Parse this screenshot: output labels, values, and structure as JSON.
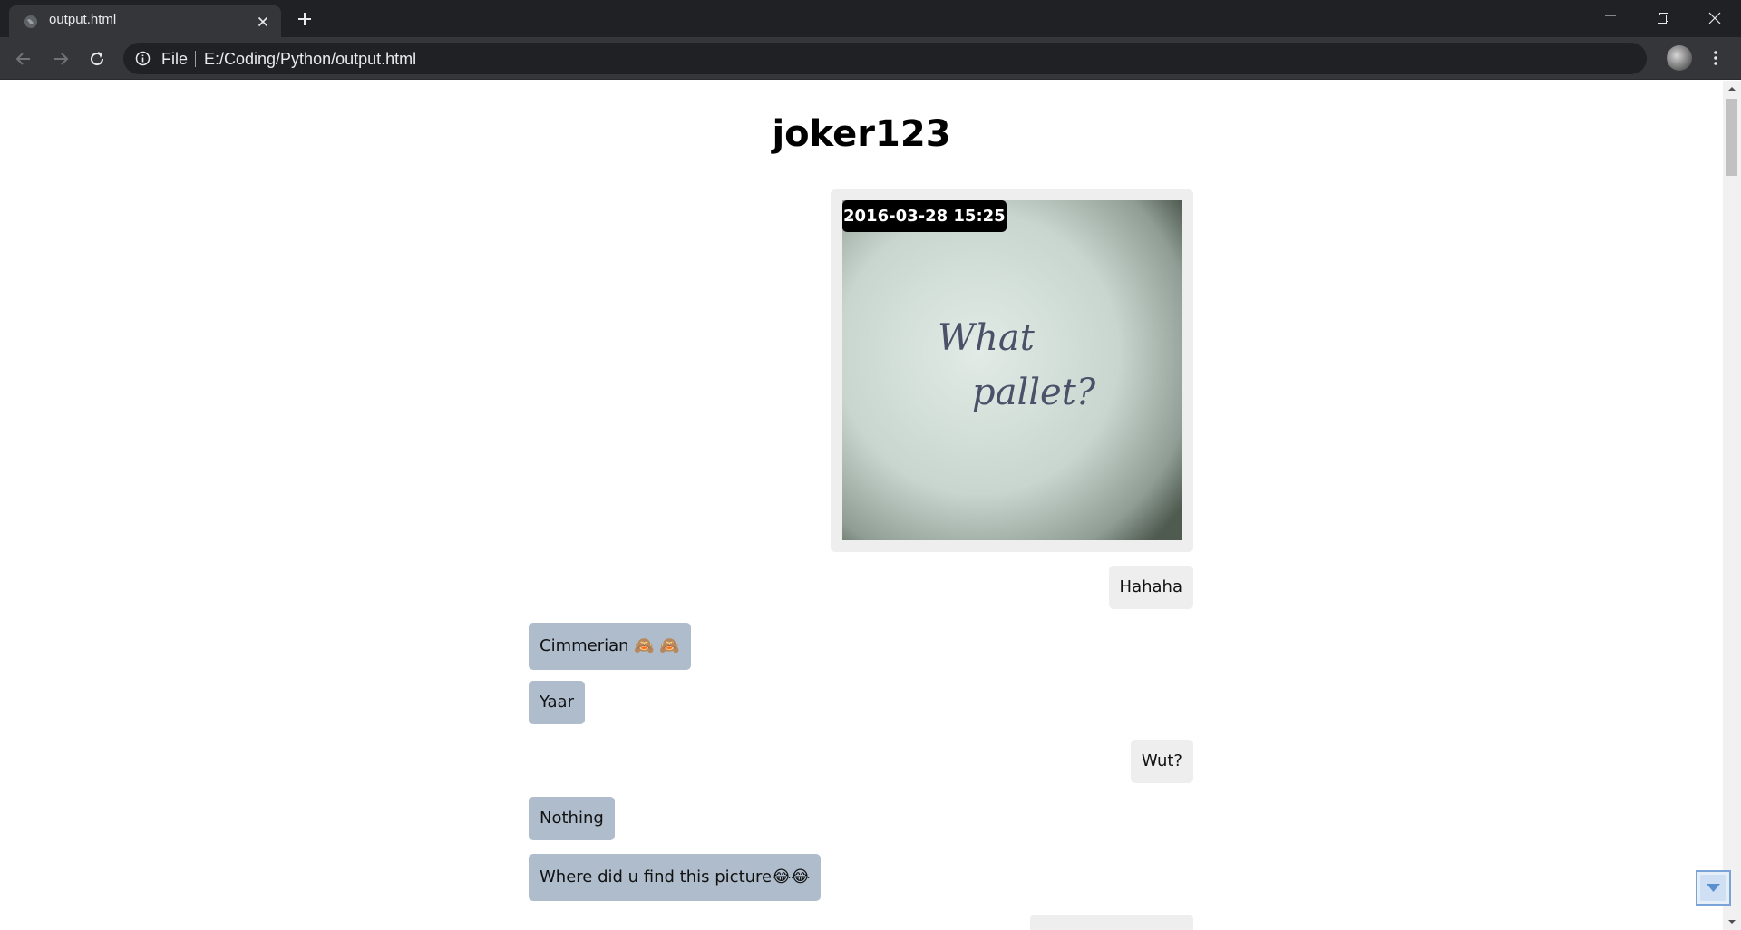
{
  "browser": {
    "tab_title": "output.html",
    "url_scheme": "File",
    "url": "E:/Coding/Python/output.html"
  },
  "chat": {
    "title": "joker123",
    "photo": {
      "timestamp": "2016-03-28 15:25",
      "handwriting_line1": "What",
      "handwriting_line2": "pallet?"
    },
    "messages": [
      {
        "direction": "out",
        "text": "Hahaha"
      },
      {
        "direction": "in",
        "text": "Cimmerian 🙈 🙈"
      },
      {
        "direction": "in",
        "text": "Yaar"
      },
      {
        "direction": "out",
        "text": "Wut?"
      },
      {
        "direction": "in",
        "text": "Nothing"
      },
      {
        "direction": "in",
        "text": "Where did u find this picture😂😂"
      },
      {
        "direction": "out",
        "text": ""
      }
    ]
  },
  "colors": {
    "outgoing_bubble": "#eeeeee",
    "incoming_bubble": "#aebccc",
    "timestamp_bg": "#000000",
    "tabbar_bg": "#202124",
    "toolbar_bg": "#35363a"
  },
  "icons": {
    "tab_favicon": "globe-icon",
    "tab_close": "close-icon",
    "new_tab": "plus-icon",
    "back": "arrow-left-icon",
    "forward": "arrow-right-icon",
    "reload": "reload-icon",
    "site_info": "info-icon",
    "bookmark": "star-icon",
    "menu": "kebab-menu-icon",
    "jump": "arrow-down-icon"
  }
}
